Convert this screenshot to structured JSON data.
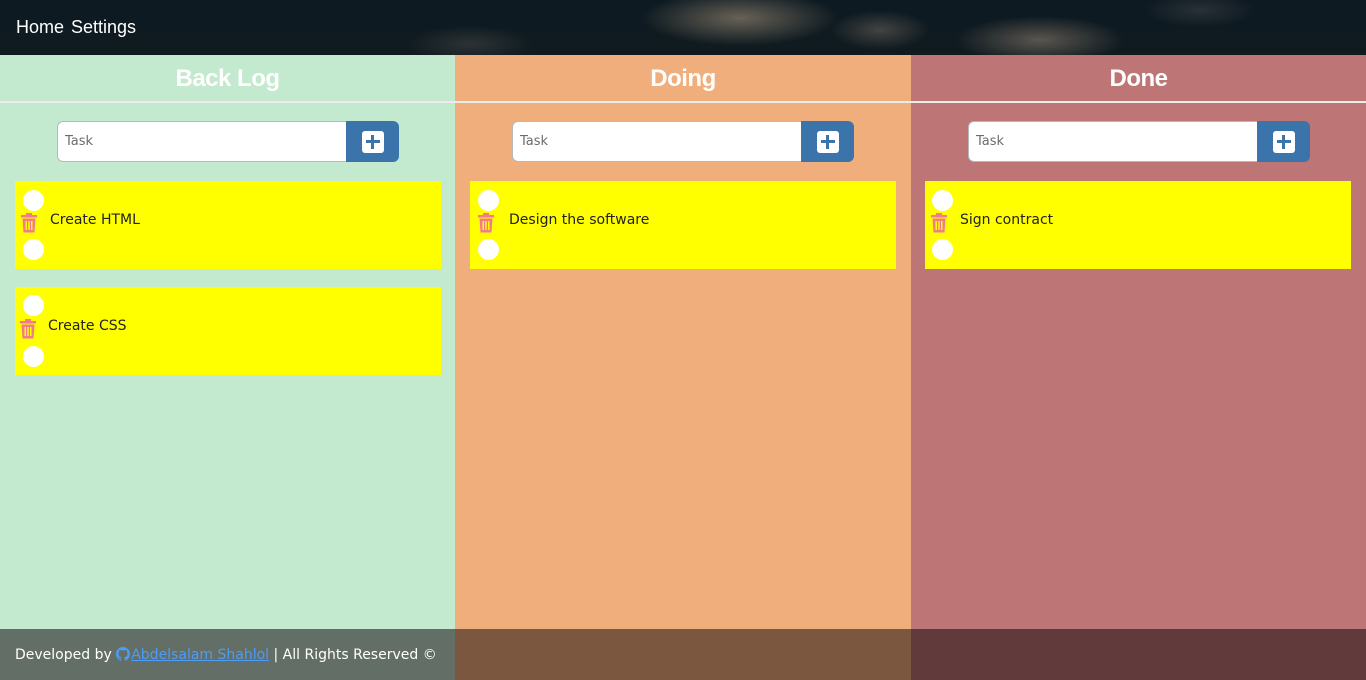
{
  "nav": {
    "items": [
      {
        "label": "Home"
      },
      {
        "label": "Settings"
      }
    ]
  },
  "columns": [
    {
      "title": "Back Log",
      "input_placeholder": "Task",
      "add_icon": "plus-square-icon",
      "color": "#c3e9cf",
      "cards": [
        {
          "text": "Create HTML"
        },
        {
          "text": "Create CSS"
        }
      ]
    },
    {
      "title": "Doing",
      "input_placeholder": "Task",
      "add_icon": "plus-square-icon",
      "color": "#efae7c",
      "cards": [
        {
          "text": "Design the software"
        }
      ]
    },
    {
      "title": "Done",
      "input_placeholder": "Task",
      "add_icon": "plus-square-icon",
      "color": "#bd7575",
      "cards": [
        {
          "text": "Sign contract"
        }
      ]
    }
  ],
  "card_style": {
    "background": "#ffff00",
    "trash_icon": "trash-icon",
    "trash_color": "#f47b8e"
  },
  "footer": {
    "prefix": "Developed by ",
    "author": "Abdelsalam Shahlol",
    "author_icon": "github-icon",
    "suffix": " | All Rights Reserved ©"
  }
}
